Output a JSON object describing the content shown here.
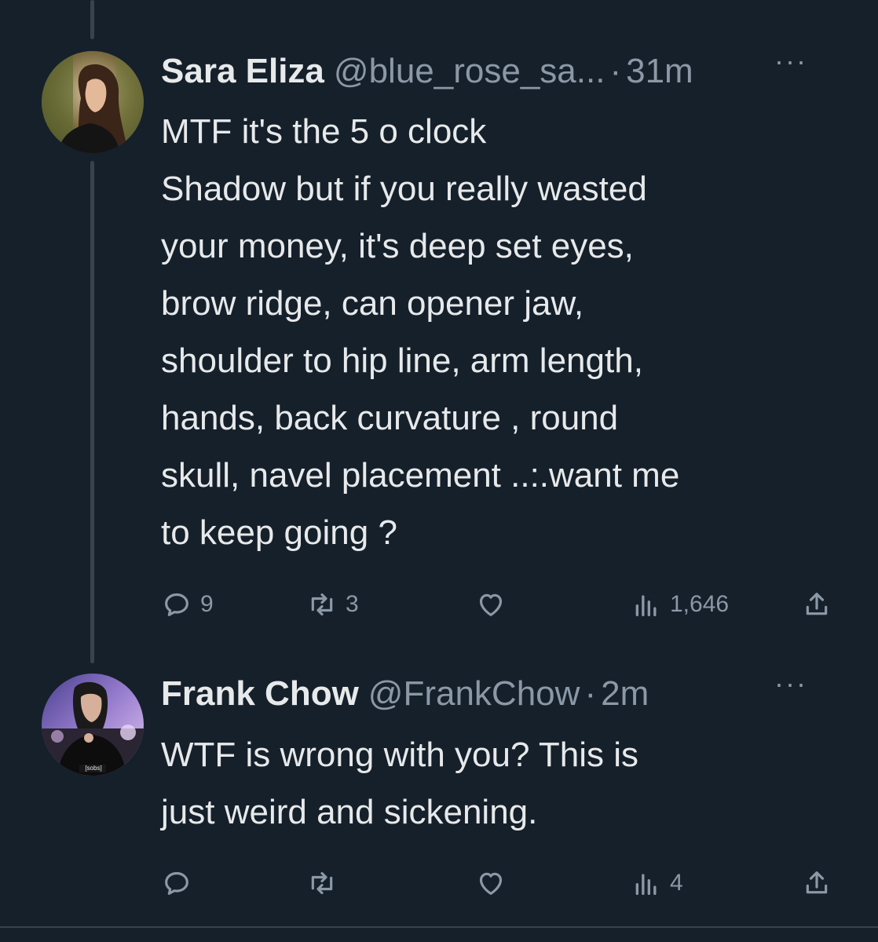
{
  "tweets": [
    {
      "name": "Sara Eliza",
      "handle": "@blue_rose_sa...",
      "separator": "·",
      "time": "31m",
      "more": "···",
      "lines": [
        "MTF it's the 5 o clock",
        "Shadow but if you really wasted",
        "your money, it's deep set eyes,",
        "brow ridge, can opener jaw,",
        "shoulder to hip line, arm length,",
        "hands, back curvature , round",
        "skull, navel placement ..:.want me",
        "to keep going ?"
      ],
      "replies": "9",
      "retweets": "3",
      "likes": "",
      "views": "1,646"
    },
    {
      "name": "Frank Chow",
      "handle": "@FrankChow",
      "separator": "·",
      "time": "2m",
      "more": "···",
      "lines": [
        "WTF is wrong with you? This is",
        "just weird and sickening."
      ],
      "avatar_caption": "[sobs]",
      "replies": "",
      "retweets": "",
      "likes": "",
      "views": "4"
    }
  ],
  "icons": {
    "reply": "reply-icon",
    "retweet": "retweet-icon",
    "like": "heart-icon",
    "views": "views-icon",
    "share": "share-icon"
  },
  "colors": {
    "background": "#15202b",
    "text": "#e7e9ea",
    "muted": "#8b98a5",
    "divider": "#38444d"
  }
}
